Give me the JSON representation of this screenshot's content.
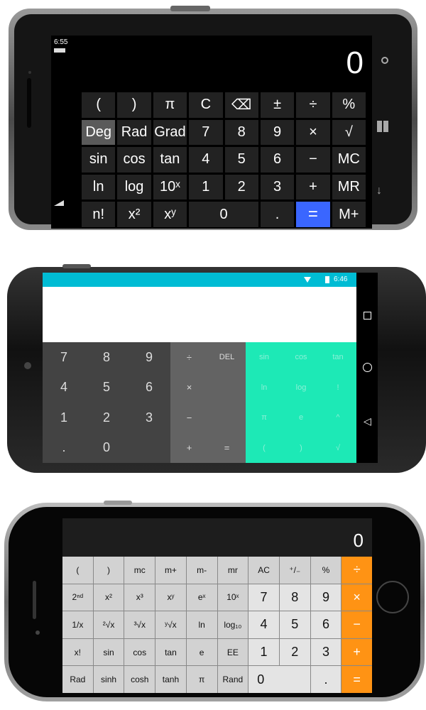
{
  "phone1": {
    "time": "6:55",
    "display": "0",
    "keys": [
      [
        "(",
        ")",
        "π",
        "C",
        "⌫",
        "±",
        "÷",
        "%"
      ],
      [
        "Deg",
        "Rad",
        "Grad",
        "7",
        "8",
        "9",
        "×",
        "√"
      ],
      [
        "sin",
        "cos",
        "tan",
        "4",
        "5",
        "6",
        "−",
        "MC"
      ],
      [
        "ln",
        "log",
        "10ˣ",
        "1",
        "2",
        "3",
        "+",
        "MR"
      ],
      [
        "n!",
        "x²",
        "xʸ",
        "0",
        ".",
        "=",
        "M+"
      ]
    ],
    "side_icons": [
      "search-icon",
      "windows-icon",
      "down-arrow-icon"
    ]
  },
  "phone2": {
    "time": "6:46",
    "digits": [
      [
        "7",
        "8",
        "9"
      ],
      [
        "4",
        "5",
        "6"
      ],
      [
        "1",
        "2",
        "3"
      ],
      [
        ".",
        "0",
        ""
      ]
    ],
    "ops": [
      [
        "÷",
        "DEL"
      ],
      [
        "×",
        ""
      ],
      [
        "−",
        ""
      ],
      [
        "+",
        "="
      ]
    ],
    "sci": [
      [
        "sin",
        "cos",
        "tan"
      ],
      [
        "ln",
        "log",
        "!"
      ],
      [
        "π",
        "e",
        "^"
      ],
      [
        "(",
        ")",
        "√"
      ]
    ],
    "nav_icons": [
      "square-icon",
      "circle-icon",
      "back-triangle-icon"
    ]
  },
  "phone3": {
    "display": "0",
    "rows": [
      [
        "(",
        ")",
        "mc",
        "m+",
        "m-",
        "mr",
        "AC",
        "⁺/₋",
        "%",
        "÷"
      ],
      [
        "2ⁿᵈ",
        "x²",
        "x³",
        "xʸ",
        "eˣ",
        "10ˣ",
        "7",
        "8",
        "9",
        "×"
      ],
      [
        "1/x",
        "²√x",
        "³√x",
        "ʸ√x",
        "ln",
        "log₁₀",
        "4",
        "5",
        "6",
        "−"
      ],
      [
        "x!",
        "sin",
        "cos",
        "tan",
        "e",
        "EE",
        "1",
        "2",
        "3",
        "+"
      ],
      [
        "Rad",
        "sinh",
        "cosh",
        "tanh",
        "π",
        "Rand",
        "0",
        ".",
        "="
      ]
    ]
  }
}
